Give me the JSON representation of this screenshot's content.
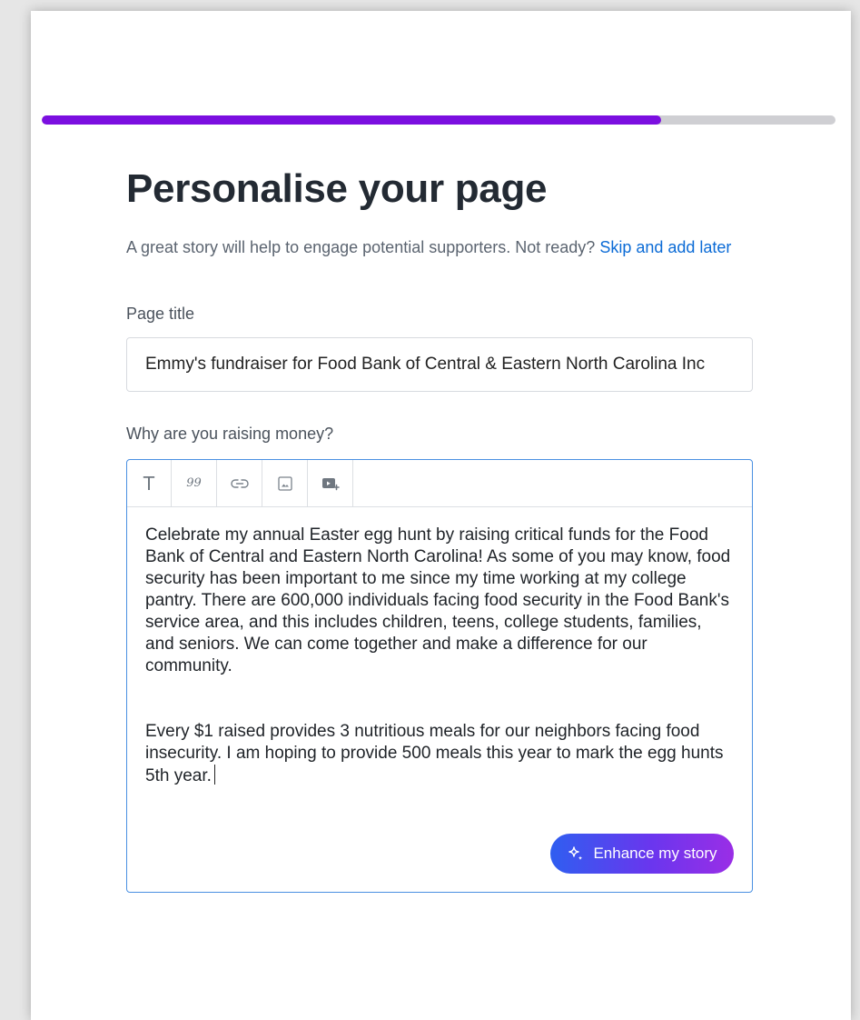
{
  "progress": {
    "percent": 78,
    "fill_color": "#7b0fe0",
    "track_color": "#cfcfd3"
  },
  "page": {
    "heading": "Personalise your page",
    "subtitle": "A great story will help to engage potential supporters. Not ready?",
    "skip_link": "Skip and add later"
  },
  "title_field": {
    "label": "Page title",
    "value": "Emmy's fundraiser for Food Bank of Central & Eastern North Carolina Inc"
  },
  "story_field": {
    "label": "Why are you raising money?",
    "toolbar": [
      {
        "icon": "text-format-icon",
        "glyph": "T"
      },
      {
        "icon": "quote-icon",
        "glyph": "99"
      },
      {
        "icon": "link-icon"
      },
      {
        "icon": "image-icon"
      },
      {
        "icon": "video-icon"
      }
    ],
    "paragraphs": [
      "Celebrate my annual Easter egg hunt by raising critical funds for the Food Bank of Central and Eastern North Carolina! As some of you may know, food security has been important to me since my time working at my college pantry. There are 600,000 individuals facing food security in the Food Bank's service area, and this includes children, teens, college students, families, and seniors. We can come together and make a difference for our community.",
      "Every $1 raised provides 3 nutritious meals for our neighbors facing food insecurity. I am hoping to provide 500 meals this year to mark the egg hunts 5th year."
    ],
    "enhance_button": {
      "label": "Enhance my story",
      "icon": "sparkle-icon"
    }
  },
  "colors": {
    "link": "#0b6bd6",
    "editor_border": "#4a90e2",
    "button_gradient_start": "#2f5ef0",
    "button_gradient_end": "#9a2ee6"
  }
}
